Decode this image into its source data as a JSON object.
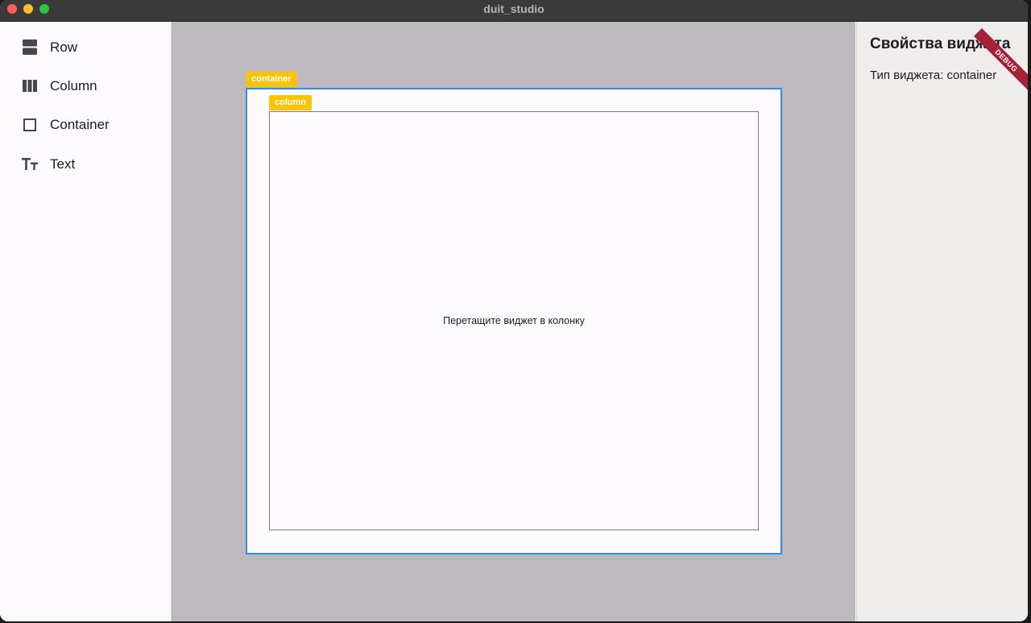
{
  "window": {
    "title": "duit_studio"
  },
  "sidebar": {
    "items": [
      {
        "label": "Row",
        "icon": "row-icon"
      },
      {
        "label": "Column",
        "icon": "column-icon"
      },
      {
        "label": "Container",
        "icon": "container-icon"
      },
      {
        "label": "Text",
        "icon": "text-icon"
      }
    ]
  },
  "canvas": {
    "container_tag": "container",
    "column_tag": "column",
    "column_placeholder": "Перетащите виджет в колонку"
  },
  "properties": {
    "title": "Свойства виджета",
    "widget_type": "Тип виджета: container",
    "debug_banner": "DEBUG"
  },
  "colors": {
    "tag_yellow": "#f7c40a",
    "selection_blue": "#2e8fe6",
    "canvas_gray": "#beb9be",
    "debug_red": "#a5213a"
  }
}
